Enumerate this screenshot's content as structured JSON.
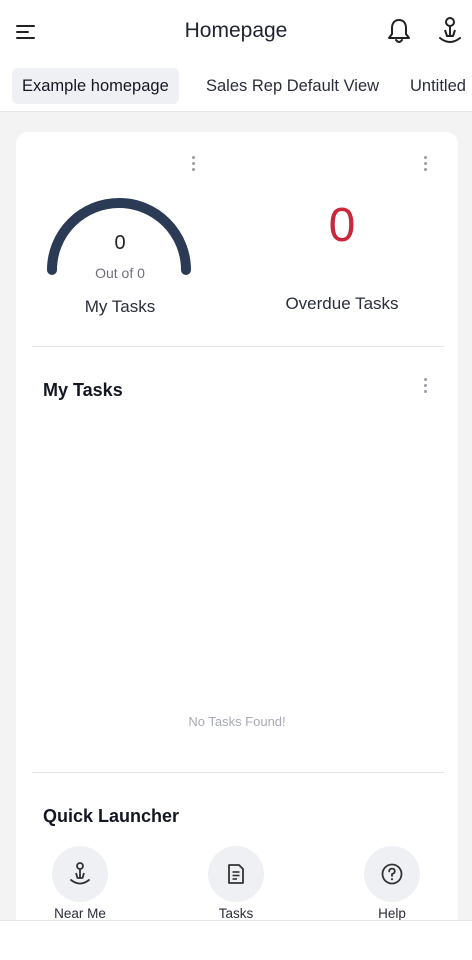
{
  "header": {
    "title": "Homepage",
    "icons": [
      "menu-icon",
      "bell-icon",
      "user-location-icon"
    ]
  },
  "tabs": [
    {
      "label": "Example homepage",
      "active": true
    },
    {
      "label": "Sales Rep Default View",
      "active": false
    },
    {
      "label": "Untitled",
      "active": false
    }
  ],
  "gauge": {
    "value": "0",
    "subtitle": "Out of 0",
    "label": "My Tasks",
    "color": "#2b3a55"
  },
  "overdue": {
    "value": "0",
    "label": "Overdue Tasks",
    "color": "#c8283a"
  },
  "my_tasks": {
    "title": "My Tasks",
    "empty_text": "No Tasks Found!"
  },
  "quick_launcher": {
    "title": "Quick Launcher",
    "items": [
      {
        "label": "Near Me",
        "icon": "near-me-icon"
      },
      {
        "label": "Tasks",
        "icon": "tasks-icon"
      },
      {
        "label": "Help",
        "icon": "help-icon"
      }
    ]
  }
}
